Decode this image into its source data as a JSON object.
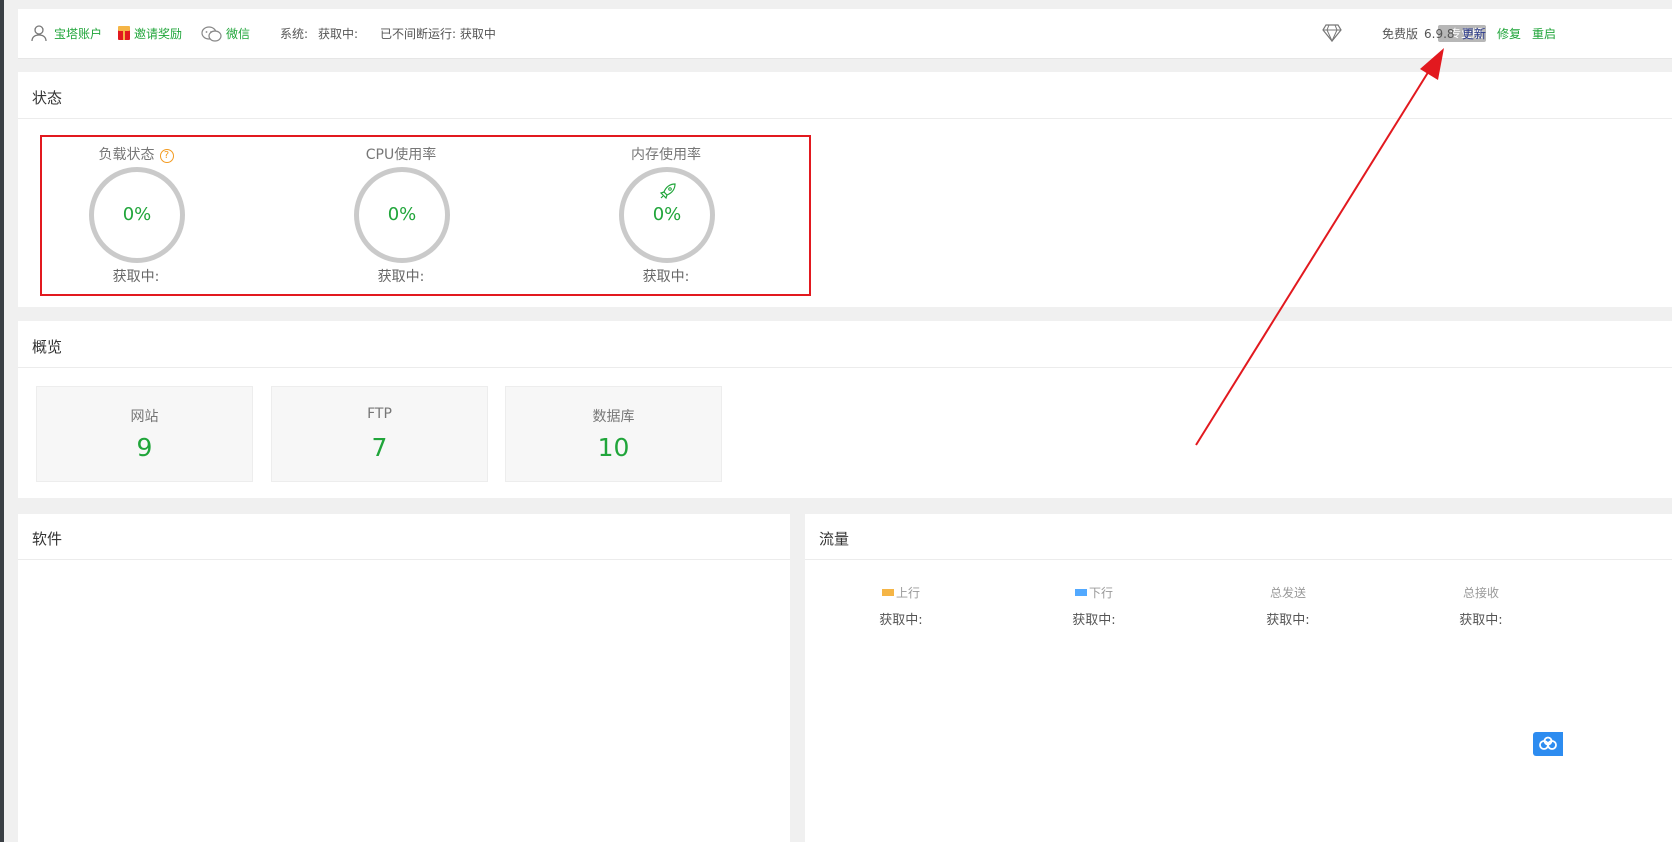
{
  "topbar": {
    "account": "宝塔账户",
    "invite": "邀请奖励",
    "wechat": "微信",
    "system_label": "系统:",
    "system_value": "获取中:",
    "uptime": "已不间断运行: 获取中",
    "pro_badge": "专业版",
    "edition": "免费版",
    "version": "6.9.8",
    "update": "更新",
    "repair": "修复",
    "restart": "重启"
  },
  "status": {
    "title": "状态",
    "gauges": [
      {
        "label": "负载状态",
        "value": "0%",
        "sub": "获取中:"
      },
      {
        "label": "CPU使用率",
        "value": "0%",
        "sub": "获取中:"
      },
      {
        "label": "内存使用率",
        "value": "0%",
        "sub": "获取中:"
      }
    ],
    "help_mark": "?"
  },
  "overview": {
    "title": "概览",
    "cards": [
      {
        "label": "网站",
        "value": "9"
      },
      {
        "label": "FTP",
        "value": "7"
      },
      {
        "label": "数据库",
        "value": "10"
      }
    ]
  },
  "software": {
    "title": "软件"
  },
  "flow": {
    "title": "流量",
    "columns": [
      {
        "label": "上行",
        "value": "获取中:",
        "color": "#f5b546"
      },
      {
        "label": "下行",
        "value": "获取中:",
        "color": "#52a9ff"
      },
      {
        "label": "总发送",
        "value": "获取中:"
      },
      {
        "label": "总接收",
        "value": "获取中:"
      }
    ]
  },
  "colors": {
    "accent": "#20a53a",
    "annotation": "#e2191f",
    "link": "#2b3a8c"
  }
}
